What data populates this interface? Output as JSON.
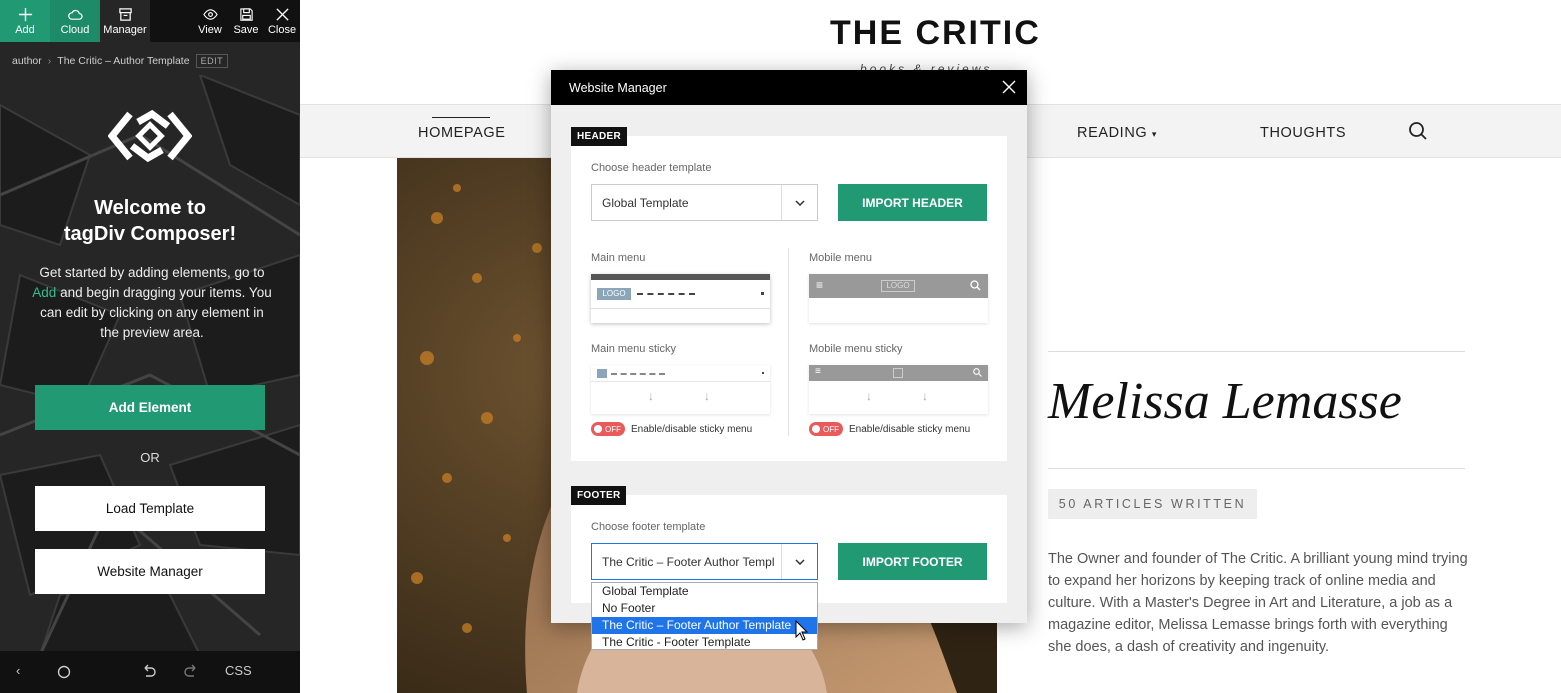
{
  "toolbar": {
    "add": "Add",
    "cloud": "Cloud",
    "manager": "Manager",
    "view": "View",
    "save": "Save",
    "close": "Close"
  },
  "breadcrumb": {
    "parent": "author",
    "current": "The Critic – Author Template",
    "edit": "EDIT"
  },
  "sidebar": {
    "welcome_line1": "Welcome to",
    "welcome_line2": "tagDiv Composer!",
    "intro_before": "Get started by adding elements, go to",
    "intro_link": "Add",
    "intro_after": "and begin dragging your items. You can edit by clicking on any element in the preview area.",
    "add_element": "Add Element",
    "or": "OR",
    "load_template": "Load Template",
    "website_manager": "Website Manager",
    "css": "CSS"
  },
  "site": {
    "title": "THE CRITIC",
    "tagline": "books & reviews",
    "nav": {
      "home": "HOMEPAGE",
      "reading": "READING",
      "thoughts": "THOUGHTS"
    },
    "author_name": "Melissa Lemasse",
    "articles": "50 ARTICLES WRITTEN",
    "bio": "The Owner and founder of The Critic. A brilliant young mind trying to expand her horizons by keeping track of online media and culture. With a Master's Degree in Art and Literature, a job as a magazine editor, Melissa Lemasse brings forth with everything she does, a dash of creativity and ingenuity."
  },
  "modal": {
    "title": "Website Manager",
    "header": {
      "tag": "HEADER",
      "choose_label": "Choose header template",
      "selected": "Global Template",
      "import": "IMPORT HEADER",
      "main_menu": "Main menu",
      "mobile_menu": "Mobile menu",
      "main_menu_sticky": "Main menu sticky",
      "mobile_menu_sticky": "Mobile menu sticky",
      "toggle_state": "OFF",
      "toggle_label": "Enable/disable sticky menu",
      "logo_text": "LOGO"
    },
    "footer": {
      "tag": "FOOTER",
      "choose_label": "Choose footer template",
      "selected": "The Critic – Footer Author Templ",
      "import": "IMPORT FOOTER",
      "options": [
        "Global Template",
        "No Footer",
        "The Critic – Footer Author Template",
        "The Critic - Footer Template"
      ],
      "highlighted_index": 2
    }
  },
  "colors": {
    "accent": "#219a74",
    "dark": "#262626",
    "select_highlight": "#1e74e8"
  }
}
